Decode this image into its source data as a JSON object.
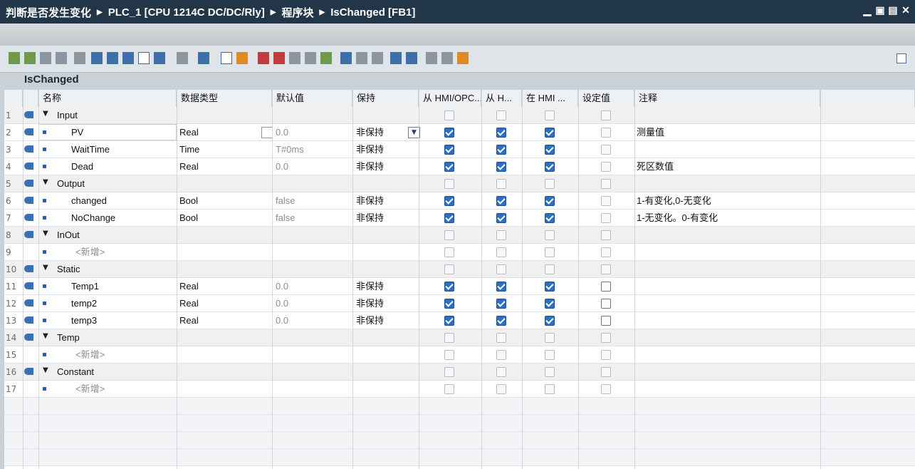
{
  "window": {
    "crumbs": [
      "判断是否发生变化",
      "PLC_1 [CPU 1214C DC/DC/Rly]",
      "程序块",
      "IsChanged [FB1]"
    ],
    "controls": [
      "minimize-icon",
      "restore-icon",
      "maximize-icon",
      "close-icon"
    ]
  },
  "block_title": "IsChanged",
  "columns": [
    "名称",
    "数据类型",
    "默认值",
    "保持",
    "从 HMI/OPC...",
    "从 H...",
    "在 HMI ...",
    "设定值",
    "注释"
  ],
  "rows": [
    {
      "num": "1",
      "name": "Input",
      "group": true,
      "type": "",
      "default": "",
      "retain": "",
      "c1": false,
      "c2": false,
      "c3": false,
      "c4": false,
      "comment": ""
    },
    {
      "num": "2",
      "name": "PV",
      "group": false,
      "type": "Real",
      "default": "0.0",
      "retain": "非保持",
      "c1": true,
      "c2": true,
      "c3": true,
      "c4": false,
      "comment": "测量值",
      "selected": true
    },
    {
      "num": "3",
      "name": "WaitTime",
      "group": false,
      "type": "Time",
      "default": "T#0ms",
      "retain": "非保持",
      "c1": true,
      "c2": true,
      "c3": true,
      "c4": false,
      "comment": ""
    },
    {
      "num": "4",
      "name": "Dead",
      "group": false,
      "type": "Real",
      "default": "0.0",
      "retain": "非保持",
      "c1": true,
      "c2": true,
      "c3": true,
      "c4": false,
      "comment": "死区数值"
    },
    {
      "num": "5",
      "name": "Output",
      "group": true,
      "type": "",
      "default": "",
      "retain": "",
      "c1": false,
      "c2": false,
      "c3": false,
      "c4": false,
      "comment": ""
    },
    {
      "num": "6",
      "name": "changed",
      "group": false,
      "type": "Bool",
      "default": "false",
      "retain": "非保持",
      "c1": true,
      "c2": true,
      "c3": true,
      "c4": false,
      "comment": "1-有变化,0-无变化"
    },
    {
      "num": "7",
      "name": "NoChange",
      "group": false,
      "type": "Bool",
      "default": "false",
      "retain": "非保持",
      "c1": true,
      "c2": true,
      "c3": true,
      "c4": false,
      "comment": "1-无变化。0-有变化"
    },
    {
      "num": "8",
      "name": "InOut",
      "group": true,
      "type": "",
      "default": "",
      "retain": "",
      "c1": false,
      "c2": false,
      "c3": false,
      "c4": false,
      "comment": ""
    },
    {
      "num": "9",
      "name": "<新增>",
      "group": false,
      "add": true,
      "type": "",
      "default": "",
      "retain": "",
      "c1": false,
      "c2": false,
      "c3": false,
      "c4": false,
      "comment": ""
    },
    {
      "num": "10",
      "name": "Static",
      "group": true,
      "type": "",
      "default": "",
      "retain": "",
      "c1": false,
      "c2": false,
      "c3": false,
      "c4": false,
      "comment": ""
    },
    {
      "num": "11",
      "name": "Temp1",
      "group": false,
      "type": "Real",
      "default": "0.0",
      "retain": "非保持",
      "c1": true,
      "c2": true,
      "c3": true,
      "c4": false,
      "c4dark": true,
      "comment": ""
    },
    {
      "num": "12",
      "name": "temp2",
      "group": false,
      "type": "Real",
      "default": "0.0",
      "retain": "非保持",
      "c1": true,
      "c2": true,
      "c3": true,
      "c4": false,
      "c4dark": true,
      "comment": ""
    },
    {
      "num": "13",
      "name": "temp3",
      "group": false,
      "type": "Real",
      "default": "0.0",
      "retain": "非保持",
      "c1": true,
      "c2": true,
      "c3": true,
      "c4": false,
      "c4dark": true,
      "comment": ""
    },
    {
      "num": "14",
      "name": "Temp",
      "group": true,
      "type": "",
      "default": "",
      "retain": "",
      "c1": false,
      "c2": false,
      "c3": false,
      "c4": false,
      "comment": ""
    },
    {
      "num": "15",
      "name": "<新增>",
      "group": false,
      "add": true,
      "type": "",
      "default": "",
      "retain": "",
      "c1": false,
      "c2": false,
      "c3": false,
      "c4": false,
      "comment": ""
    },
    {
      "num": "16",
      "name": "Constant",
      "group": true,
      "type": "",
      "default": "",
      "retain": "",
      "c1": false,
      "c2": false,
      "c3": false,
      "c4": false,
      "comment": ""
    },
    {
      "num": "17",
      "name": "<新增>",
      "group": false,
      "add": true,
      "type": "",
      "default": "",
      "retain": "",
      "c1": false,
      "c2": false,
      "c3": false,
      "c4": false,
      "comment": ""
    }
  ],
  "colors": {
    "accent": "#2f6fc2",
    "titlebar": "#213648"
  }
}
